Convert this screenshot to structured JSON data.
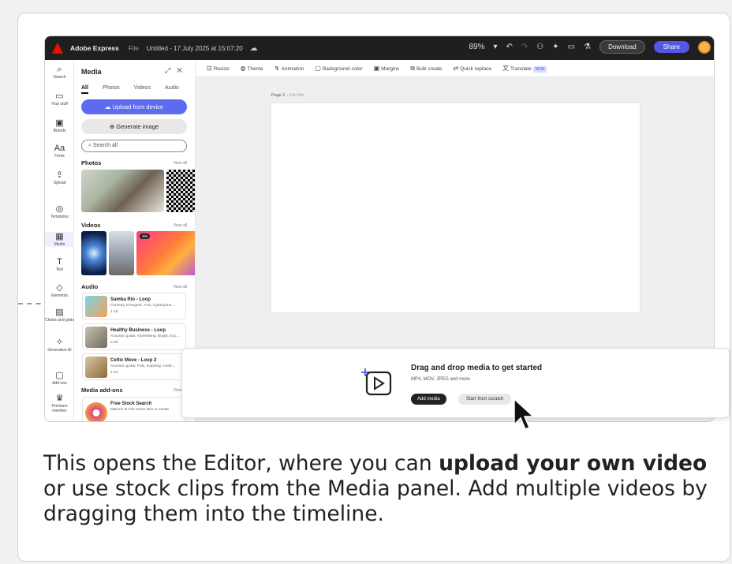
{
  "topbar": {
    "app_name": "Adobe Express",
    "file_menu": "File",
    "doc_title": "Untitled - 17 July 2025 at 15:07:20",
    "zoom": "89%",
    "download": "Download",
    "share": "Share"
  },
  "rail": {
    "items": [
      {
        "label": "Search"
      },
      {
        "label": "Your stuff"
      },
      {
        "label": "Brands"
      },
      {
        "label": "Fonts"
      },
      {
        "label": "Upload"
      },
      {
        "label": "Templates"
      },
      {
        "label": "Media"
      },
      {
        "label": "Text"
      },
      {
        "label": "Elements"
      },
      {
        "label": "Charts and grids"
      },
      {
        "label": "Generative AI"
      },
      {
        "label": "Add-ons"
      },
      {
        "label": "Premium member"
      }
    ]
  },
  "panel": {
    "title": "Media",
    "tabs": [
      "All",
      "Photos",
      "Videos",
      "Audio"
    ],
    "upload_label": "Upload from device",
    "generate_label": "Generate image",
    "search_placeholder": "Search all",
    "photos_heading": "Photos",
    "videos_heading": "Videos",
    "audio_heading": "Audio",
    "view_all": "View all",
    "video_badge": "30s",
    "audio_items": [
      {
        "title": "Samba Rio - Loop",
        "sub": "Comedy, Energetic, Fun, Cyberpunk...",
        "dur": "1:16"
      },
      {
        "title": "Healthy Business - Loop",
        "sub": "Acoustic guitar, Advertising, Bright, Exc...",
        "dur": "2:28"
      },
      {
        "title": "Celtic Move - Loop 2",
        "sub": "Acoustic guitar, Folk, Inspiring, Celtic...",
        "dur": "1:44"
      }
    ],
    "addons_heading": "Media add-ons",
    "addon_title": "Free Stock Search",
    "addon_sub": "Millions of free Stock files in Adobe"
  },
  "canvas_toolbar": {
    "items": [
      "Resize",
      "Theme",
      "Animation",
      "Background color",
      "Margins",
      "Bulk create",
      "Quick replace",
      "Translate"
    ],
    "new_badge": "NEW"
  },
  "canvas": {
    "page_label": "Page 1 -",
    "add_title": "Add title"
  },
  "dnd": {
    "title": "Drag and drop media to get started",
    "sub": "MP4, MOV, JPEG and more",
    "add_media": "Add media",
    "start_scratch": "Start from scratch"
  },
  "caption": {
    "part1": "This opens the Editor, where you can ",
    "bold1": "upload your own video",
    "part2": " or use stock clips from the Media panel. Add multiple videos by dragging them into the timeline."
  },
  "colors": {
    "accent": "#5258e4",
    "topbar": "#1f1f1f"
  }
}
